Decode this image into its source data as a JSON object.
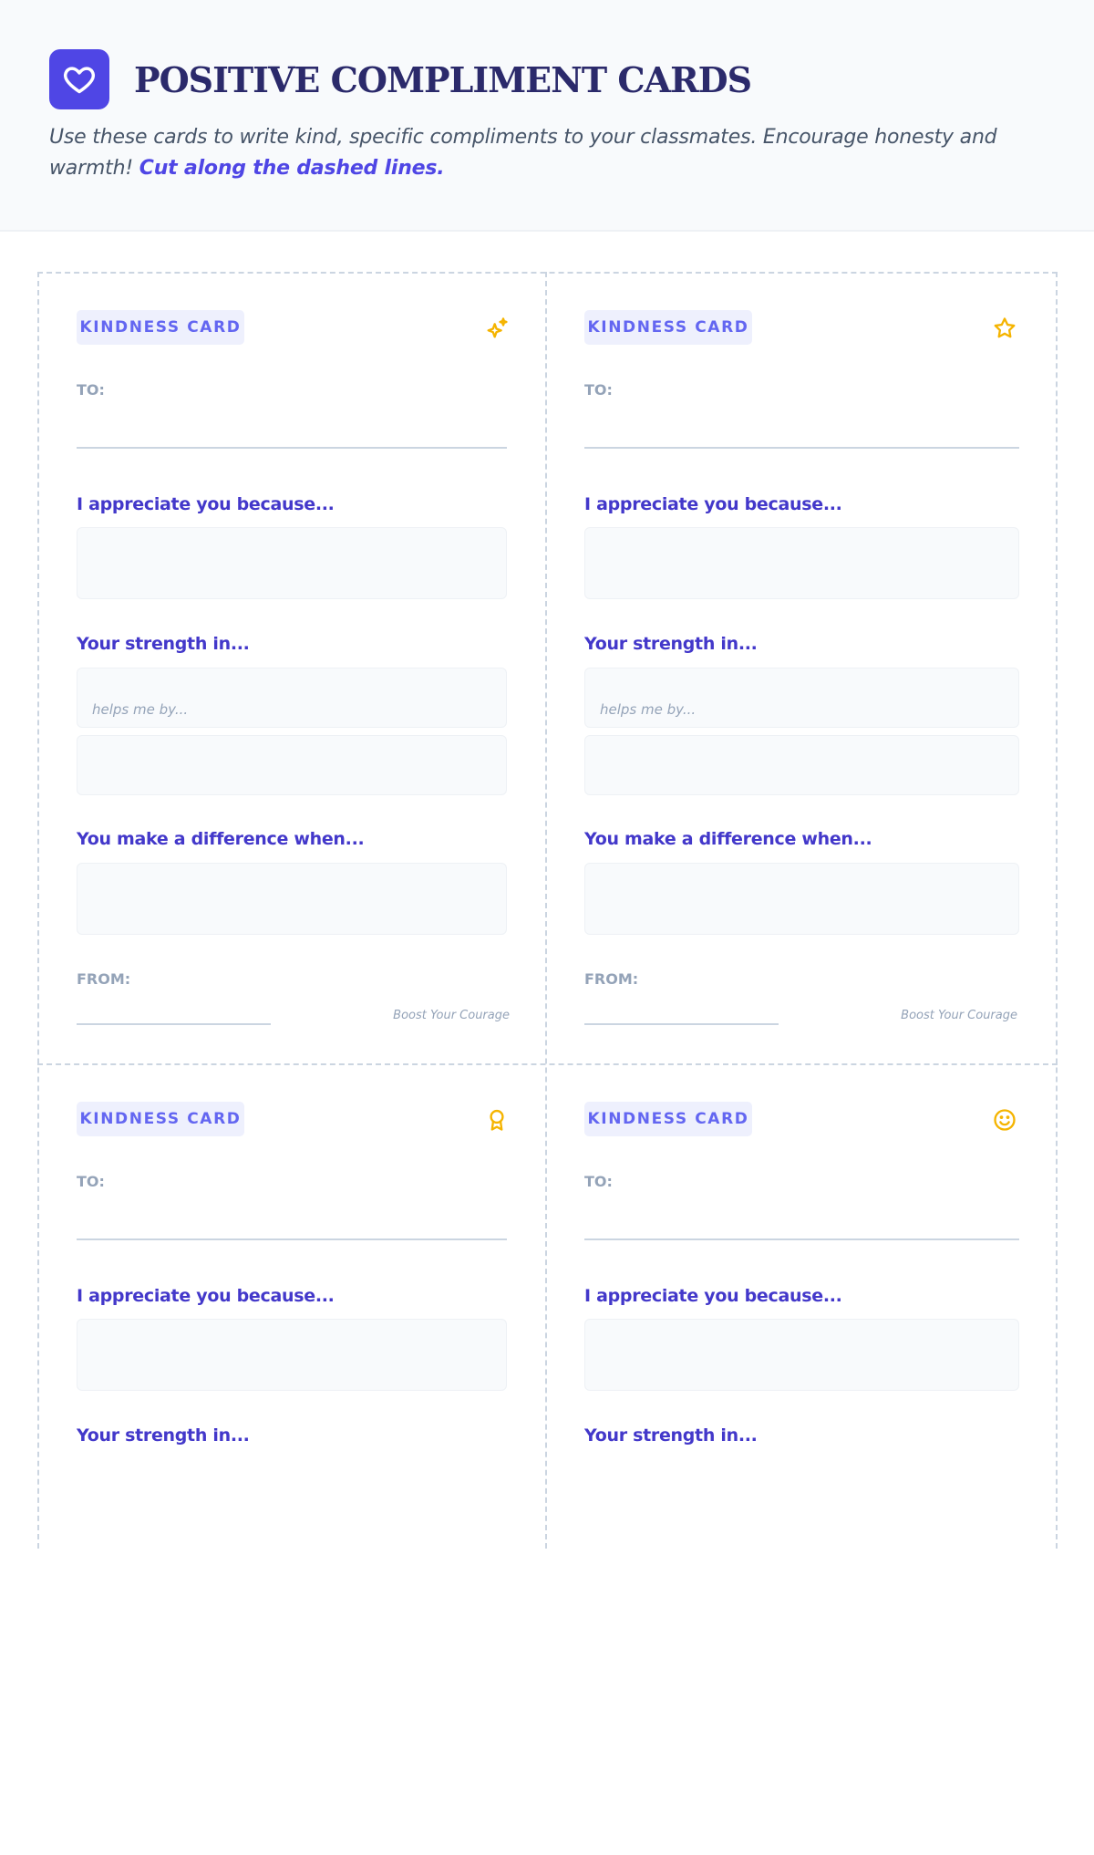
{
  "header": {
    "logo_icon": "heart-icon",
    "title": "POSITIVE COMPLIMENT CARDS",
    "intro": "Use these cards to write kind, specific compliments to your classmates. Encourage honesty and warmth!",
    "intro_emphasis": "Cut along the dashed lines."
  },
  "colors": {
    "accent": "#4f46e5",
    "prompt": "#4338ca",
    "badge_bg": "#eef0fd",
    "icon": "#f5b400",
    "cut_line": "#cbd5e1"
  },
  "cards": [
    {
      "badge": "KINDNESS CARD",
      "icon": "sparkles-icon",
      "to_label": "TO:",
      "prompt_appreciate": "I appreciate you because...",
      "prompt_strength": "Your strength in...",
      "strength_hint": "helps me by...",
      "prompt_difference": "You make a difference when...",
      "from_label": "FROM:",
      "footnote": "Boost Your Courage"
    },
    {
      "badge": "KINDNESS CARD",
      "icon": "star-icon",
      "to_label": "TO:",
      "prompt_appreciate": "I appreciate you because...",
      "prompt_strength": "Your strength in...",
      "strength_hint": "helps me by...",
      "prompt_difference": "You make a difference when...",
      "from_label": "FROM:",
      "footnote": "Boost Your Courage"
    },
    {
      "badge": "KINDNESS CARD",
      "icon": "award-ribbon-icon",
      "to_label": "TO:",
      "prompt_appreciate": "I appreciate you because...",
      "prompt_strength": "Your strength in..."
    },
    {
      "badge": "KINDNESS CARD",
      "icon": "smile-icon",
      "to_label": "TO:",
      "prompt_appreciate": "I appreciate you because...",
      "prompt_strength": "Your strength in..."
    }
  ]
}
